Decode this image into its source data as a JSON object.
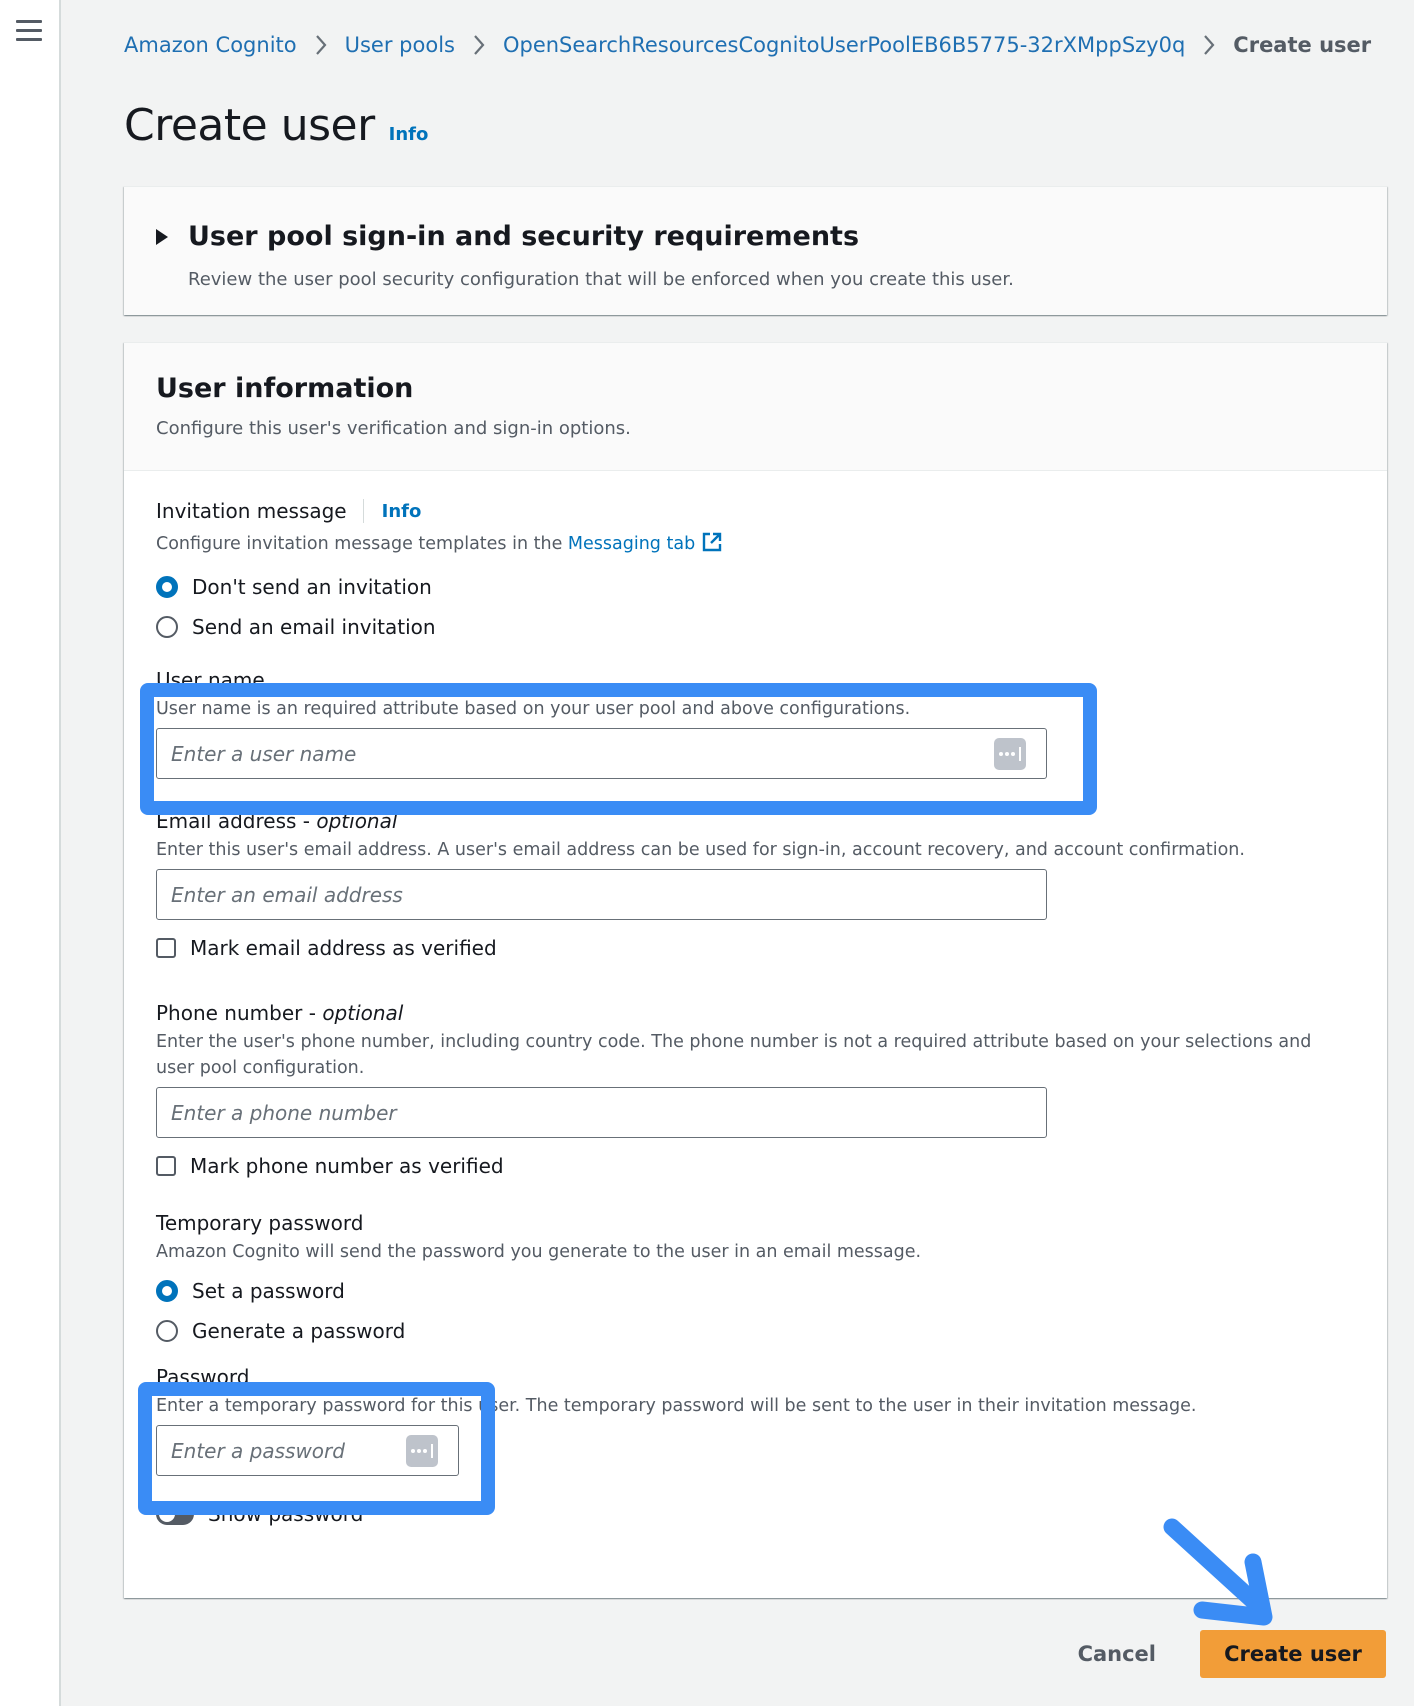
{
  "nav": {
    "menu_icon": "hamburger-menu-icon"
  },
  "breadcrumb": {
    "items": [
      "Amazon Cognito",
      "User pools",
      "OpenSearchResourcesCognitoUserPoolEB6B5775-32rXMppSzy0q"
    ],
    "current": "Create user"
  },
  "header": {
    "title": "Create user",
    "info": "Info"
  },
  "security_section": {
    "title": "User pool sign-in and security requirements",
    "description": "Review the user pool security configuration that will be enforced when you create this user.",
    "expanded": false
  },
  "user_info": {
    "title": "User information",
    "description": "Configure this user's verification and sign-in options.",
    "invitation": {
      "label": "Invitation message",
      "info": "Info",
      "hint_prefix": "Configure invitation message templates in the ",
      "hint_link": "Messaging tab",
      "options": [
        {
          "label": "Don't send an invitation",
          "selected": true
        },
        {
          "label": "Send an email invitation",
          "selected": false
        }
      ]
    },
    "username": {
      "label": "User name",
      "hint": "User name is an required attribute based on your user pool and above configurations.",
      "placeholder": "Enter a user name",
      "value": ""
    },
    "email": {
      "label": "Email address - ",
      "label_optional": "optional",
      "hint": "Enter this user's email address. A user's email address can be used for sign-in, account recovery, and account confirmation.",
      "placeholder": "Enter an email address",
      "value": "",
      "verify_label": "Mark email address as verified",
      "verified": false
    },
    "phone": {
      "label": "Phone number - ",
      "label_optional": "optional",
      "hint": "Enter the user's phone number, including country code. The phone number is not a required attribute based on your selections and user pool configuration.",
      "placeholder": "Enter a phone number",
      "value": "",
      "verify_label": "Mark phone number as verified",
      "verified": false
    },
    "temp_password": {
      "label": "Temporary password",
      "hint": "Amazon Cognito will send the password you generate to the user in an email message.",
      "options": [
        {
          "label": "Set a password",
          "selected": true
        },
        {
          "label": "Generate a password",
          "selected": false
        }
      ]
    },
    "password": {
      "label": "Password",
      "hint": "Enter a temporary password for this user. The temporary password will be sent to the user in their invitation message.",
      "placeholder": "Enter a password",
      "value": "",
      "show_label": "Show password",
      "show": false
    }
  },
  "actions": {
    "cancel": "Cancel",
    "submit": "Create user"
  },
  "colors": {
    "link": "#0073bb",
    "primary_button": "#f29d38",
    "annotation": "#3a8cf5"
  }
}
